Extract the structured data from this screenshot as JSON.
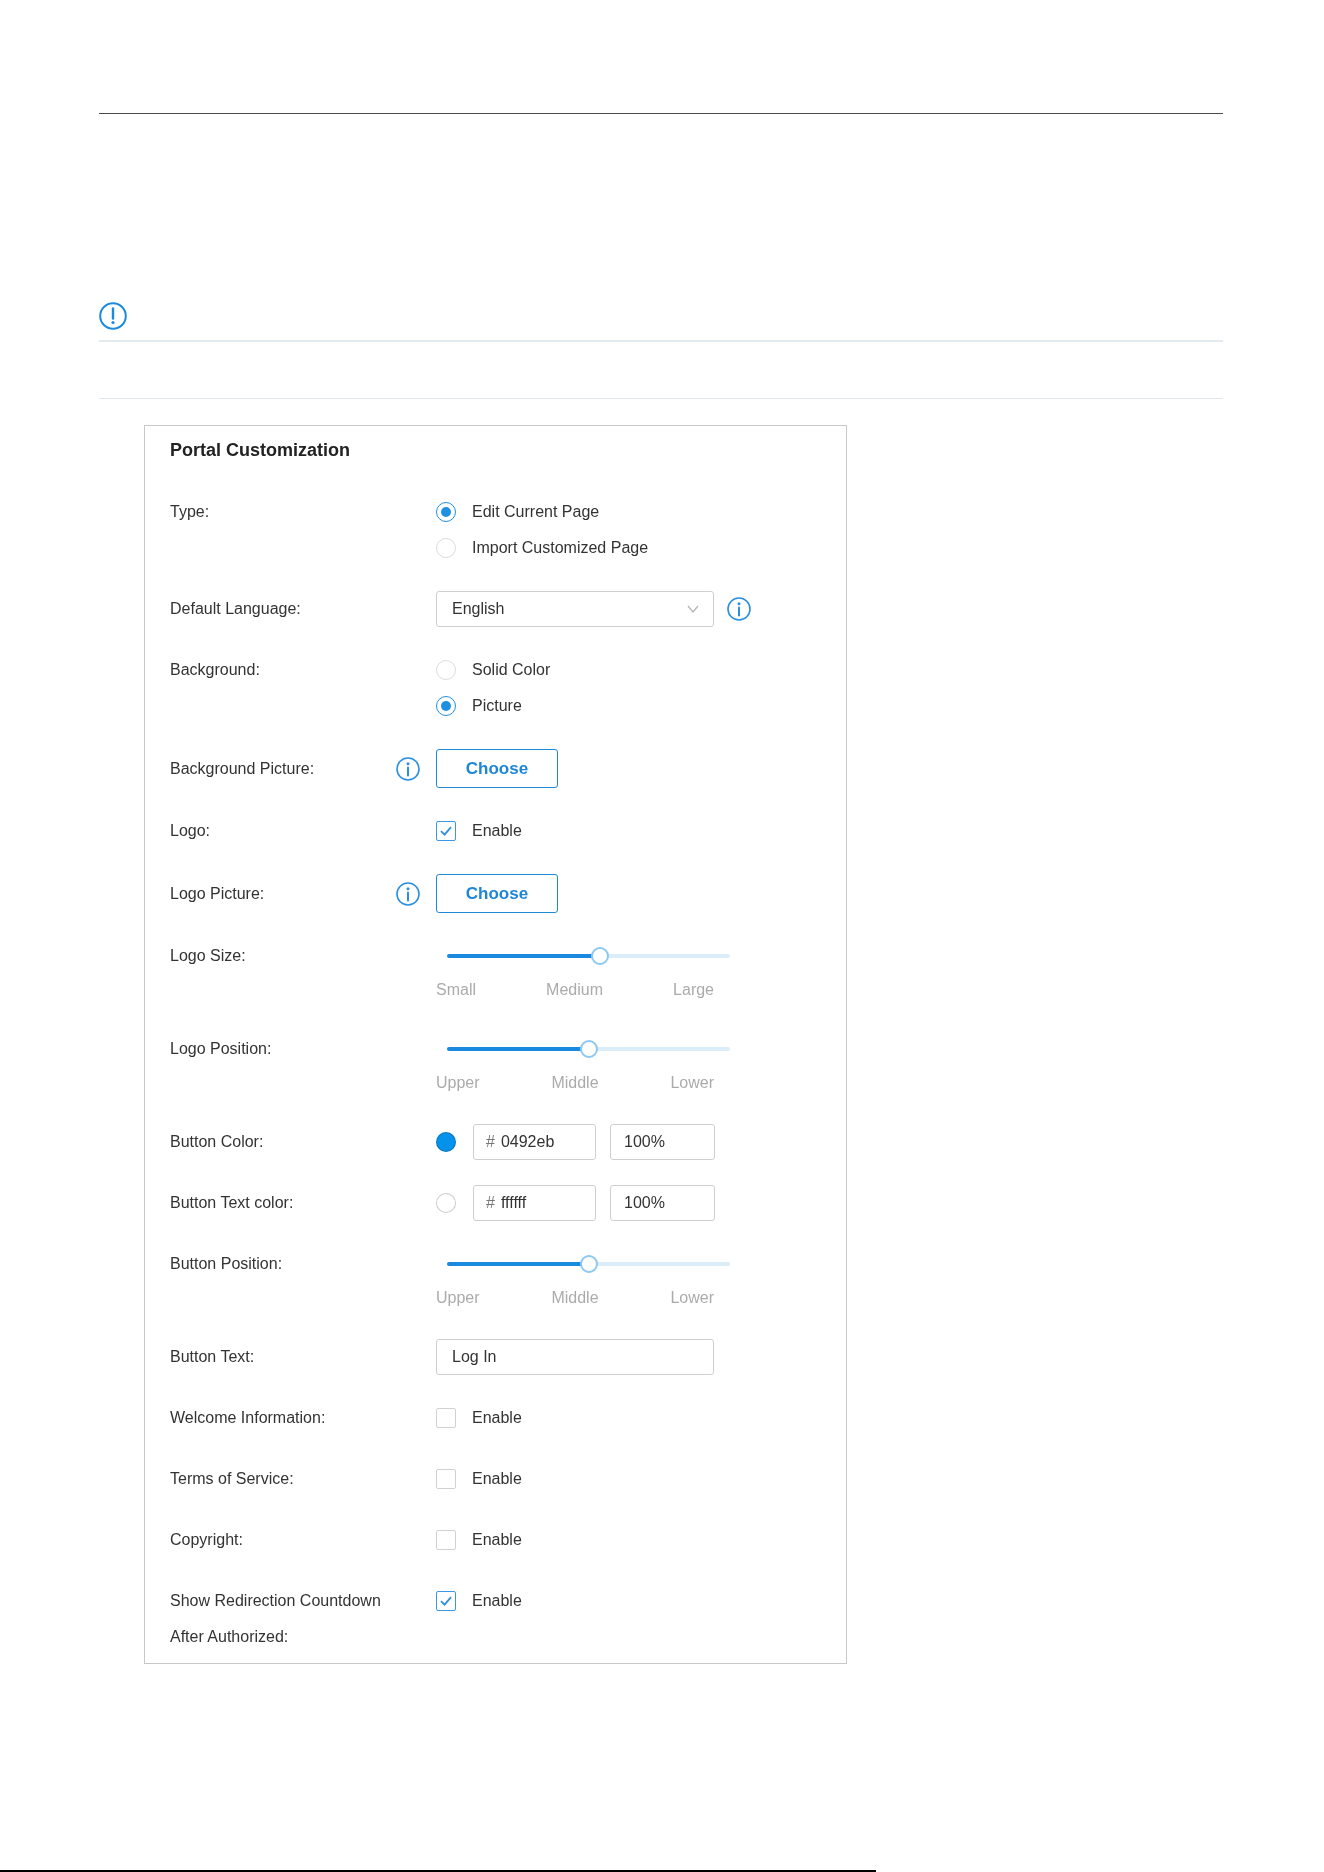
{
  "card": {
    "title": "Portal Customization",
    "rows": [
      {
        "kind": "radio",
        "label": "Type:",
        "options": [
          {
            "label": "Edit Current Page",
            "selected": true
          },
          {
            "label": "Import Customized Page",
            "selected": false
          }
        ]
      },
      {
        "kind": "select",
        "label": "Default Language:",
        "value": "English",
        "info": true
      },
      {
        "kind": "radio",
        "label": "Background:",
        "options": [
          {
            "label": "Solid Color",
            "selected": false
          },
          {
            "label": "Picture",
            "selected": true
          }
        ]
      },
      {
        "kind": "file",
        "label": "Background Picture:",
        "button": "Choose",
        "info": true
      },
      {
        "kind": "checkbox",
        "label": "Logo:",
        "option": "Enable",
        "checked": true
      },
      {
        "kind": "file",
        "label": "Logo Picture:",
        "button": "Choose",
        "info": true
      },
      {
        "kind": "slider",
        "label": "Logo Size:",
        "level": 0.54,
        "ticks": [
          "Small",
          "Medium",
          "Large"
        ]
      },
      {
        "kind": "slider",
        "label": "Logo Position:",
        "level": 0.5,
        "ticks": [
          "Upper",
          "Middle",
          "Lower"
        ]
      },
      {
        "kind": "color",
        "label": "Button Color:",
        "color": "#0492eb",
        "hex_prefix": "#",
        "hex": "0492eb",
        "opacity": "100%"
      },
      {
        "kind": "color",
        "label": "Button Text color:",
        "color": "#ffffff",
        "hex_prefix": "#",
        "hex": "ffffff",
        "opacity": "100%"
      },
      {
        "kind": "slider",
        "label": "Button Position:",
        "level": 0.5,
        "ticks": [
          "Upper",
          "Middle",
          "Lower"
        ]
      },
      {
        "kind": "text",
        "label": "Button Text:",
        "value": "Log In"
      },
      {
        "kind": "checkbox",
        "label": "Welcome Information:",
        "option": "Enable",
        "checked": false
      },
      {
        "kind": "checkbox",
        "label": "Terms of Service:",
        "option": "Enable",
        "checked": false
      },
      {
        "kind": "checkbox",
        "label": "Copyright:",
        "option": "Enable",
        "checked": false
      },
      {
        "kind": "checkbox",
        "label": "Show Redirection Countdown After Authorized:",
        "option": "Enable",
        "checked": true
      }
    ]
  }
}
